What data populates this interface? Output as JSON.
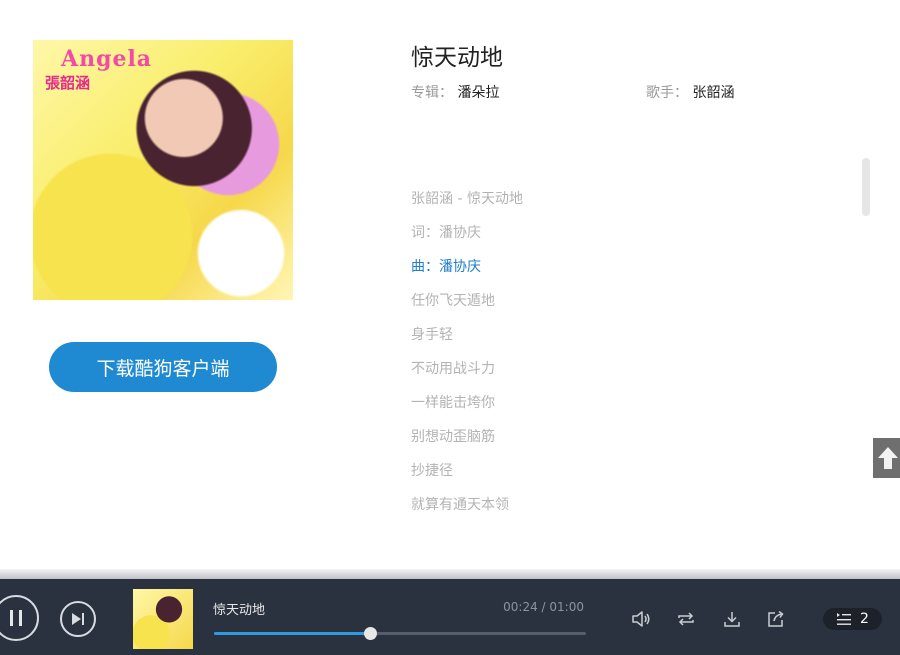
{
  "album_art": {
    "artist_en": "Angela",
    "artist_cn": "張韶涵"
  },
  "download_button": {
    "label": "下载酷狗客户端"
  },
  "song": {
    "title": "惊天动地",
    "album_label": "专辑：",
    "album": "潘朵拉",
    "singer_label": "歌手：",
    "singer": "张韶涵"
  },
  "lyrics": [
    "张韶涵 - 惊天动地",
    "词：潘协庆",
    "曲：潘协庆",
    "任你飞天遁地",
    "身手轻",
    "不动用战斗力",
    "一样能击垮你",
    "别想动歪脑筋",
    "抄捷径",
    "就算有通天本领"
  ],
  "active_lyric_index": 2,
  "player": {
    "title": "惊天动地",
    "time": "00:24 / 01:00",
    "progress": 0.42,
    "playlist_count": "2"
  },
  "colors": {
    "accent": "#1f8ad1",
    "active_lyric": "#1f7ec8",
    "player_bg": "#2b323f"
  }
}
